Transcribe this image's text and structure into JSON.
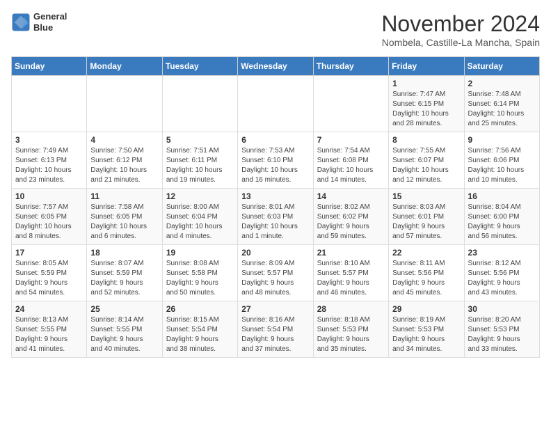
{
  "logo": {
    "line1": "General",
    "line2": "Blue"
  },
  "title": "November 2024",
  "location": "Nombela, Castille-La Mancha, Spain",
  "weekdays": [
    "Sunday",
    "Monday",
    "Tuesday",
    "Wednesday",
    "Thursday",
    "Friday",
    "Saturday"
  ],
  "weeks": [
    [
      {
        "day": "",
        "info": ""
      },
      {
        "day": "",
        "info": ""
      },
      {
        "day": "",
        "info": ""
      },
      {
        "day": "",
        "info": ""
      },
      {
        "day": "",
        "info": ""
      },
      {
        "day": "1",
        "info": "Sunrise: 7:47 AM\nSunset: 6:15 PM\nDaylight: 10 hours\nand 28 minutes."
      },
      {
        "day": "2",
        "info": "Sunrise: 7:48 AM\nSunset: 6:14 PM\nDaylight: 10 hours\nand 25 minutes."
      }
    ],
    [
      {
        "day": "3",
        "info": "Sunrise: 7:49 AM\nSunset: 6:13 PM\nDaylight: 10 hours\nand 23 minutes."
      },
      {
        "day": "4",
        "info": "Sunrise: 7:50 AM\nSunset: 6:12 PM\nDaylight: 10 hours\nand 21 minutes."
      },
      {
        "day": "5",
        "info": "Sunrise: 7:51 AM\nSunset: 6:11 PM\nDaylight: 10 hours\nand 19 minutes."
      },
      {
        "day": "6",
        "info": "Sunrise: 7:53 AM\nSunset: 6:10 PM\nDaylight: 10 hours\nand 16 minutes."
      },
      {
        "day": "7",
        "info": "Sunrise: 7:54 AM\nSunset: 6:08 PM\nDaylight: 10 hours\nand 14 minutes."
      },
      {
        "day": "8",
        "info": "Sunrise: 7:55 AM\nSunset: 6:07 PM\nDaylight: 10 hours\nand 12 minutes."
      },
      {
        "day": "9",
        "info": "Sunrise: 7:56 AM\nSunset: 6:06 PM\nDaylight: 10 hours\nand 10 minutes."
      }
    ],
    [
      {
        "day": "10",
        "info": "Sunrise: 7:57 AM\nSunset: 6:05 PM\nDaylight: 10 hours\nand 8 minutes."
      },
      {
        "day": "11",
        "info": "Sunrise: 7:58 AM\nSunset: 6:05 PM\nDaylight: 10 hours\nand 6 minutes."
      },
      {
        "day": "12",
        "info": "Sunrise: 8:00 AM\nSunset: 6:04 PM\nDaylight: 10 hours\nand 4 minutes."
      },
      {
        "day": "13",
        "info": "Sunrise: 8:01 AM\nSunset: 6:03 PM\nDaylight: 10 hours\nand 1 minute."
      },
      {
        "day": "14",
        "info": "Sunrise: 8:02 AM\nSunset: 6:02 PM\nDaylight: 9 hours\nand 59 minutes."
      },
      {
        "day": "15",
        "info": "Sunrise: 8:03 AM\nSunset: 6:01 PM\nDaylight: 9 hours\nand 57 minutes."
      },
      {
        "day": "16",
        "info": "Sunrise: 8:04 AM\nSunset: 6:00 PM\nDaylight: 9 hours\nand 56 minutes."
      }
    ],
    [
      {
        "day": "17",
        "info": "Sunrise: 8:05 AM\nSunset: 5:59 PM\nDaylight: 9 hours\nand 54 minutes."
      },
      {
        "day": "18",
        "info": "Sunrise: 8:07 AM\nSunset: 5:59 PM\nDaylight: 9 hours\nand 52 minutes."
      },
      {
        "day": "19",
        "info": "Sunrise: 8:08 AM\nSunset: 5:58 PM\nDaylight: 9 hours\nand 50 minutes."
      },
      {
        "day": "20",
        "info": "Sunrise: 8:09 AM\nSunset: 5:57 PM\nDaylight: 9 hours\nand 48 minutes."
      },
      {
        "day": "21",
        "info": "Sunrise: 8:10 AM\nSunset: 5:57 PM\nDaylight: 9 hours\nand 46 minutes."
      },
      {
        "day": "22",
        "info": "Sunrise: 8:11 AM\nSunset: 5:56 PM\nDaylight: 9 hours\nand 45 minutes."
      },
      {
        "day": "23",
        "info": "Sunrise: 8:12 AM\nSunset: 5:56 PM\nDaylight: 9 hours\nand 43 minutes."
      }
    ],
    [
      {
        "day": "24",
        "info": "Sunrise: 8:13 AM\nSunset: 5:55 PM\nDaylight: 9 hours\nand 41 minutes."
      },
      {
        "day": "25",
        "info": "Sunrise: 8:14 AM\nSunset: 5:55 PM\nDaylight: 9 hours\nand 40 minutes."
      },
      {
        "day": "26",
        "info": "Sunrise: 8:15 AM\nSunset: 5:54 PM\nDaylight: 9 hours\nand 38 minutes."
      },
      {
        "day": "27",
        "info": "Sunrise: 8:16 AM\nSunset: 5:54 PM\nDaylight: 9 hours\nand 37 minutes."
      },
      {
        "day": "28",
        "info": "Sunrise: 8:18 AM\nSunset: 5:53 PM\nDaylight: 9 hours\nand 35 minutes."
      },
      {
        "day": "29",
        "info": "Sunrise: 8:19 AM\nSunset: 5:53 PM\nDaylight: 9 hours\nand 34 minutes."
      },
      {
        "day": "30",
        "info": "Sunrise: 8:20 AM\nSunset: 5:53 PM\nDaylight: 9 hours\nand 33 minutes."
      }
    ]
  ]
}
